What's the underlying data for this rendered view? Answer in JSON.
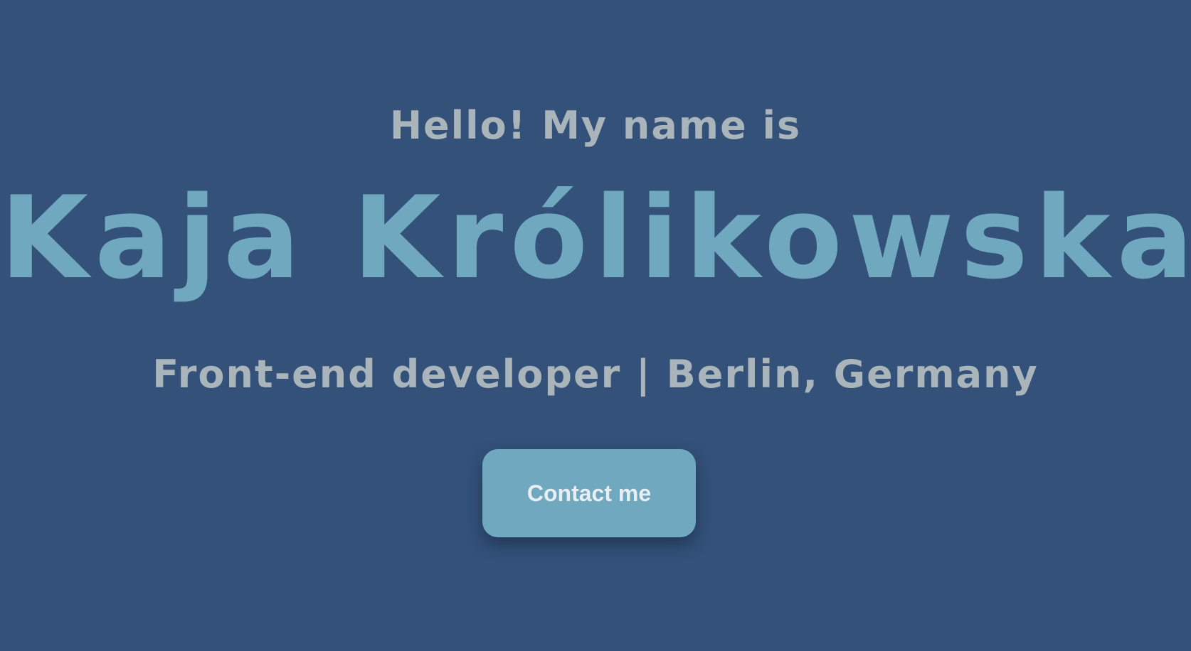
{
  "hero": {
    "greeting": "Hello! My name is",
    "name": "Kaja Królikowska",
    "tagline": "Front-end developer | Berlin, Germany",
    "contact_label": "Contact me"
  },
  "colors": {
    "background": "#335179",
    "accent": "#70a8bf",
    "muted_text": "#a9b5bb",
    "button_text": "#e8eef1"
  }
}
